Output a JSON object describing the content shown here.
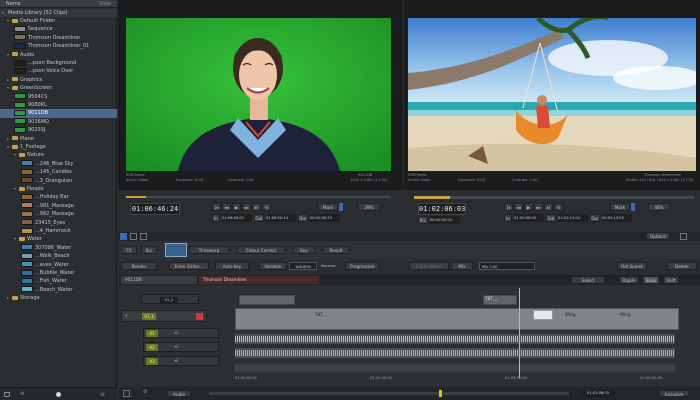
{
  "left_panel": {
    "header": {
      "name_label": "Name",
      "view_label": "View"
    },
    "library_title": "Media Library (52 Clips)",
    "tree": [
      {
        "label": "Default Folder",
        "depth": 1,
        "kind": "folder",
        "open": true
      },
      {
        "label": "Sequence",
        "depth": 2,
        "kind": "item",
        "thumb": "#8a8f94"
      },
      {
        "label": "Thomson Dreamliner",
        "depth": 2,
        "kind": "item",
        "thumb": "#7a7265"
      },
      {
        "label": "Thomson Dreamliner_01",
        "depth": 2,
        "kind": "item",
        "thumb": "#1a2a48"
      },
      {
        "label": "Audio",
        "depth": 1,
        "kind": "folder",
        "open": true
      },
      {
        "label": "...pson Background",
        "depth": 2,
        "kind": "item",
        "thumb": "#202020"
      },
      {
        "label": "...pson Voice Over",
        "depth": 2,
        "kind": "item",
        "thumb": "#202020"
      },
      {
        "label": "Graphics",
        "depth": 1,
        "kind": "folder",
        "open": false
      },
      {
        "label": "GreenScreen",
        "depth": 1,
        "kind": "folder",
        "open": true
      },
      {
        "label": "9504CS",
        "depth": 2,
        "kind": "item",
        "thumb": "#2f9a42"
      },
      {
        "label": "9080KL",
        "depth": 2,
        "kind": "item",
        "thumb": "#2f9a42"
      },
      {
        "label": "9011DB",
        "depth": 2,
        "kind": "item",
        "thumb": "#2f9a42",
        "selected": true
      },
      {
        "label": "9036MQ",
        "depth": 2,
        "kind": "item",
        "thumb": "#2f9a42"
      },
      {
        "label": "9023SJ",
        "depth": 2,
        "kind": "item",
        "thumb": "#2f9a42"
      },
      {
        "label": "Plane",
        "depth": 1,
        "kind": "folder",
        "open": false
      },
      {
        "label": "1_Footage",
        "depth": 1,
        "kind": "folder",
        "open": true
      },
      {
        "label": "Nature",
        "depth": 2,
        "kind": "folder",
        "open": true
      },
      {
        "label": "...246_Blue Sky",
        "depth": 3,
        "kind": "item",
        "thumb": "#4a7ab0"
      },
      {
        "label": "...145_Candles",
        "depth": 3,
        "kind": "item",
        "thumb": "#8a6a2a"
      },
      {
        "label": "...3_Orangutan",
        "depth": 3,
        "kind": "item",
        "thumb": "#6a4a2a"
      },
      {
        "label": "People",
        "depth": 2,
        "kind": "folder",
        "open": true
      },
      {
        "label": "...Holiday Bar",
        "depth": 3,
        "kind": "item",
        "thumb": "#a06030"
      },
      {
        "label": "...981_Massage",
        "depth": 3,
        "kind": "item",
        "thumb": "#b08060"
      },
      {
        "label": "...982_Massage",
        "depth": 3,
        "kind": "item",
        "thumb": "#a07050"
      },
      {
        "label": "23415_Eyes",
        "depth": 3,
        "kind": "item",
        "thumb": "#806050"
      },
      {
        "label": "...4_Hammock",
        "depth": 3,
        "kind": "item",
        "thumb": "#c09040"
      },
      {
        "label": "Water",
        "depth": 2,
        "kind": "folder",
        "open": true
      },
      {
        "label": "307086_Water",
        "depth": 3,
        "kind": "item",
        "thumb": "#3a80b0"
      },
      {
        "label": "...Walk_Beach",
        "depth": 3,
        "kind": "item",
        "thumb": "#7aa0b0"
      },
      {
        "label": "...aves_Water",
        "depth": 3,
        "kind": "item",
        "thumb": "#4a90b8"
      },
      {
        "label": "...Bubble_Water",
        "depth": 3,
        "kind": "item",
        "thumb": "#3a6a9a"
      },
      {
        "label": "...Fish_Water",
        "depth": 3,
        "kind": "item",
        "thumb": "#2a7aa0"
      },
      {
        "label": "...Beach_Water",
        "depth": 3,
        "kind": "item",
        "thumb": "#6ab0c0"
      },
      {
        "label": "Storage",
        "depth": 1,
        "kind": "folder",
        "open": false
      }
    ]
  },
  "source_viewer": {
    "info_left1": "RGB Mode",
    "info_left2": "Active Video",
    "info_exposure": "Exposure: 0.00",
    "info_contrast": "Contrast: 1.00",
    "info_right1": "9011DB",
    "info_right2": "1920 x 1080 (1.778)",
    "timecode": "01:06:46:24",
    "mark_label": "Mark",
    "zoom": "39%",
    "in_label": "In",
    "in_tc": "01:06:50:02",
    "out_label": "Out",
    "out_tc": "01:06:50:14",
    "dur_label": "Dur",
    "dur_tc": "00:00:00:13"
  },
  "record_viewer": {
    "info_left1": "RGB Mode",
    "info_left2": "Active Video",
    "info_exposure": "Exposure: 0.00",
    "info_contrast": "Contrast: 1.00",
    "info_right1": "Thomson Dreamliner",
    "info_right2": "ProRes 422 (HQ) 1920 x 1080 (1.778)",
    "timecode": "01:02:06:03",
    "mark_label": "Mark",
    "zoom": "46%",
    "src_label": "Src",
    "src_tc": "00:00:02:04",
    "in_label": "In",
    "in_tc": "01:00:00:00",
    "out_label": "Out",
    "out_tc": "01:01:13:04",
    "dur_label": "Dur",
    "dur_tc": "00:00:13:05"
  },
  "toolbar": {
    "options_label": "Options"
  },
  "effects": {
    "fx_label": "FX",
    "sub_label": "Src",
    "timewarp_label": "Timewarp",
    "colour_correct_label": "Colour Correct",
    "key_label": "Key",
    "result_label": "Result",
    "render_label": "Render",
    "enter_editor_label": "Enter Editor...",
    "auto_key_label": "Auto key",
    "variable_label": "Variable",
    "speed_value": "100.00%",
    "reverse_label": "Reverse",
    "progressive_label": "Progressive",
    "frame_blend_label": "Frame Blend",
    "mix_label": "Mix",
    "mix_value": "Mix 0.00",
    "rot_speed_label": "Rot Speed",
    "delete_label": "Delete"
  },
  "timeline": {
    "tab1": "9011DB",
    "tab2": "Thomson Dreamliner",
    "select_label": "Select",
    "ripple_label": "Ripple",
    "snap_label": "Snap",
    "shift_label": "Shift",
    "tracks": [
      "V1_2",
      "V1_1",
      "A1",
      "A2",
      "A3"
    ],
    "clip_labels": [
      "787_...",
      "787_...",
      "Wing...",
      "Wing..."
    ],
    "ruler": [
      "01:00:00:00",
      "01:02:00:00",
      "01:02:00:00",
      "01:05:00:00"
    ],
    "foot_audio": "Audio",
    "foot_tc": "01:02:06:03",
    "foot_mode": "Inclusive"
  },
  "colors": {
    "accent_blue": "#4a6890",
    "playhead": "#e8c200",
    "tc_yellow": "#e0c040",
    "red_rec": "#c83c3c"
  }
}
